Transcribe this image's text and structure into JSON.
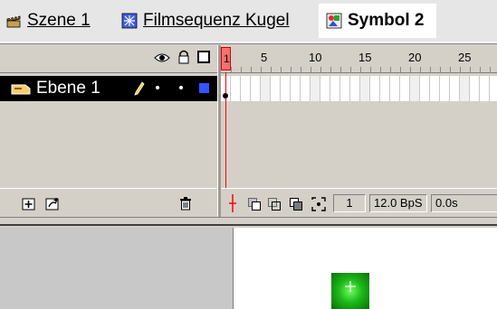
{
  "breadcrumb": {
    "items": [
      {
        "label": "Szene 1",
        "icon": "scene-clapper-icon"
      },
      {
        "label": "Filmsequenz Kugel",
        "icon": "movieclip-icon"
      },
      {
        "label": "Symbol 2",
        "icon": "graphic-symbol-icon",
        "active": true
      }
    ]
  },
  "timeline": {
    "header_icons": [
      "eye-icon",
      "lock-icon",
      "outline-square-icon"
    ],
    "ruler_numbers": [
      "5",
      "10",
      "15",
      "20",
      "25"
    ],
    "playhead_frame": "1",
    "layers": [
      {
        "name": "Ebene 1",
        "selected": true,
        "icon": "layer-icon",
        "edit_icon": "pencil-icon",
        "color": "#3355ff"
      }
    ],
    "bottom_buttons": [
      "insert-layer-icon",
      "add-guide-layer-icon",
      "delete-layer-icon"
    ],
    "status": {
      "current_frame": "1",
      "frame_rate": "12.0 BpS",
      "elapsed": "0.0s"
    }
  },
  "colors": {
    "playhead": "#ff0000",
    "selected_layer_bg": "#000000",
    "layer_color_swatch": "#3355ff",
    "symbol_fill": "#1db81a"
  }
}
